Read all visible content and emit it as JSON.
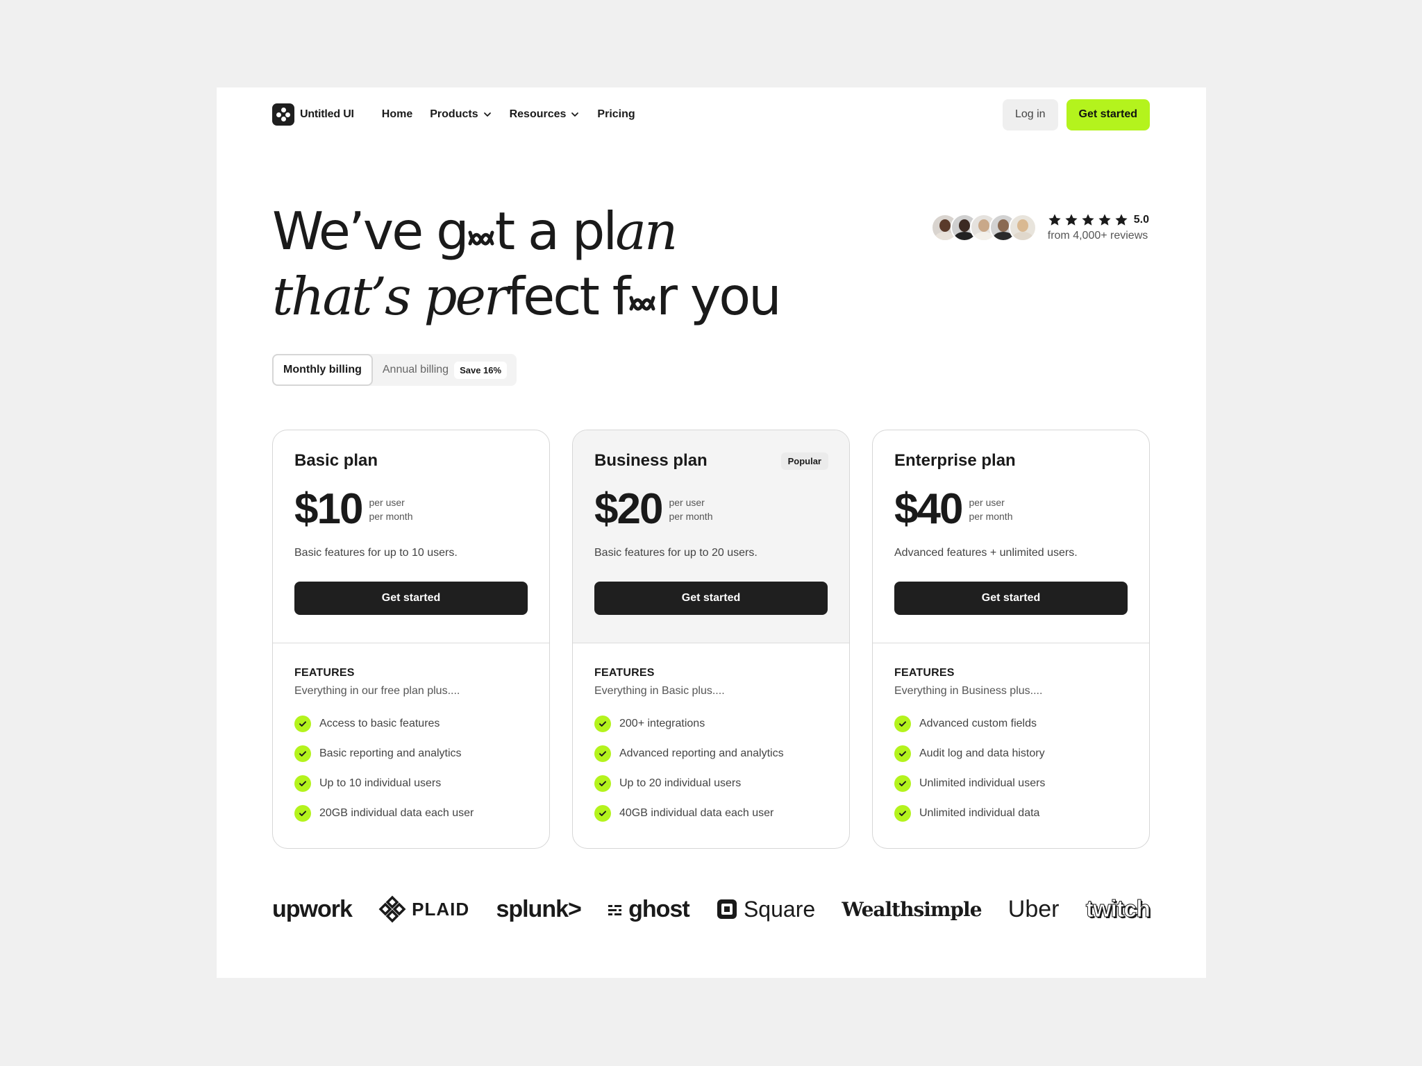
{
  "nav": {
    "logo_text": "Untitled UI",
    "links": [
      "Home",
      "Products",
      "Resources",
      "Pricing"
    ],
    "login": "Log in",
    "cta": "Get started"
  },
  "hero": {
    "line1_a": "We’ve g",
    "line1_b": "t a pl",
    "line1_c": "an",
    "line2_a": "that’s ",
    "line2_b": "per",
    "line2_c": "fect f",
    "line2_d": "r you"
  },
  "reviews": {
    "score": "5.0",
    "subtext": "from 4,000+ reviews",
    "stars": 5
  },
  "billing": {
    "monthly": "Monthly billing",
    "annual": "Annual billing",
    "save": "Save 16%"
  },
  "plans": [
    {
      "name": "Basic plan",
      "price": "$10",
      "per_line1": "per user",
      "per_line2": "per month",
      "desc": "Basic features for up to 10 users.",
      "button": "Get started",
      "features_heading": "FEATURES",
      "features_sub": "Everything in our free plan plus....",
      "features": [
        "Access to basic features",
        "Basic reporting and analytics",
        "Up to 10 individual users",
        "20GB individual data each user"
      ]
    },
    {
      "name": "Business plan",
      "badge": "Popular",
      "price": "$20",
      "per_line1": "per user",
      "per_line2": "per month",
      "desc": "Basic features for up to 20 users.",
      "button": "Get started",
      "features_heading": "FEATURES",
      "features_sub": "Everything in Basic plus....",
      "features": [
        "200+ integrations",
        "Advanced reporting and analytics",
        "Up to 20 individual users",
        "40GB individual data each user"
      ]
    },
    {
      "name": "Enterprise plan",
      "price": "$40",
      "per_line1": "per user",
      "per_line2": "per month",
      "desc": "Advanced features + unlimited users.",
      "button": "Get started",
      "features_heading": "FEATURES",
      "features_sub": "Everything in Business plus....",
      "features": [
        "Advanced custom fields",
        "Audit log and data history",
        "Unlimited individual users",
        "Unlimited individual data"
      ]
    }
  ],
  "logos": [
    "upwork",
    "PLAID",
    "splunk>",
    "ghost",
    "Square",
    "Wealthsimple",
    "Uber",
    "twitch"
  ],
  "colors": {
    "accent": "#b4f31d",
    "dark": "#1f1f1f",
    "page_bg": "#f0f0f0"
  }
}
